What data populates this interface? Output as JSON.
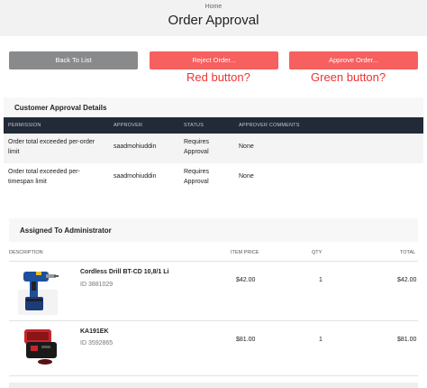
{
  "header": {
    "breadcrumb": "Home",
    "title": "Order Approval"
  },
  "buttons": {
    "back": "Back To List",
    "reject": "Reject Order...",
    "approve": "Approve Order..."
  },
  "annotations": {
    "reject": "Red button?",
    "approve": "Green button?"
  },
  "colors": {
    "button_red": "#f6605f",
    "button_gray": "#888a8c",
    "table_header": "#222a38",
    "annotation": "#ee3333"
  },
  "approval": {
    "title": "Customer Approval Details",
    "columns": [
      "PERMISSION",
      "APPROVER",
      "STATUS",
      "APPROVER COMMENTS"
    ],
    "rows": [
      {
        "permission_l1": "Order total exceeded per-order",
        "permission_l2": "limit",
        "approver": "saadmohiuddin",
        "status_l1": "Requires",
        "status_l2": "Approval",
        "comments": "None"
      },
      {
        "permission_l1": "Order total exceeded per-",
        "permission_l2": "timespan limit",
        "approver": "saadmohiuddin",
        "status_l1": "Requires",
        "status_l2": "Approval",
        "comments": "None"
      }
    ]
  },
  "items": {
    "title": "Assigned To Administrator",
    "columns": [
      "DESCRIPTION",
      "ITEM PRICE",
      "QTY",
      "TOTAL"
    ],
    "rows": [
      {
        "name": "Cordless Drill BT-CD 10,8/1 Li",
        "id": "ID 3881029",
        "price": "$42.00",
        "qty": "1",
        "total": "$42.00",
        "image": "cordless-drill-image"
      },
      {
        "name": "KA191EK",
        "id": "ID 3592865",
        "price": "$81.00",
        "qty": "1",
        "total": "$81.00",
        "image": "tool-case-image"
      }
    ]
  }
}
